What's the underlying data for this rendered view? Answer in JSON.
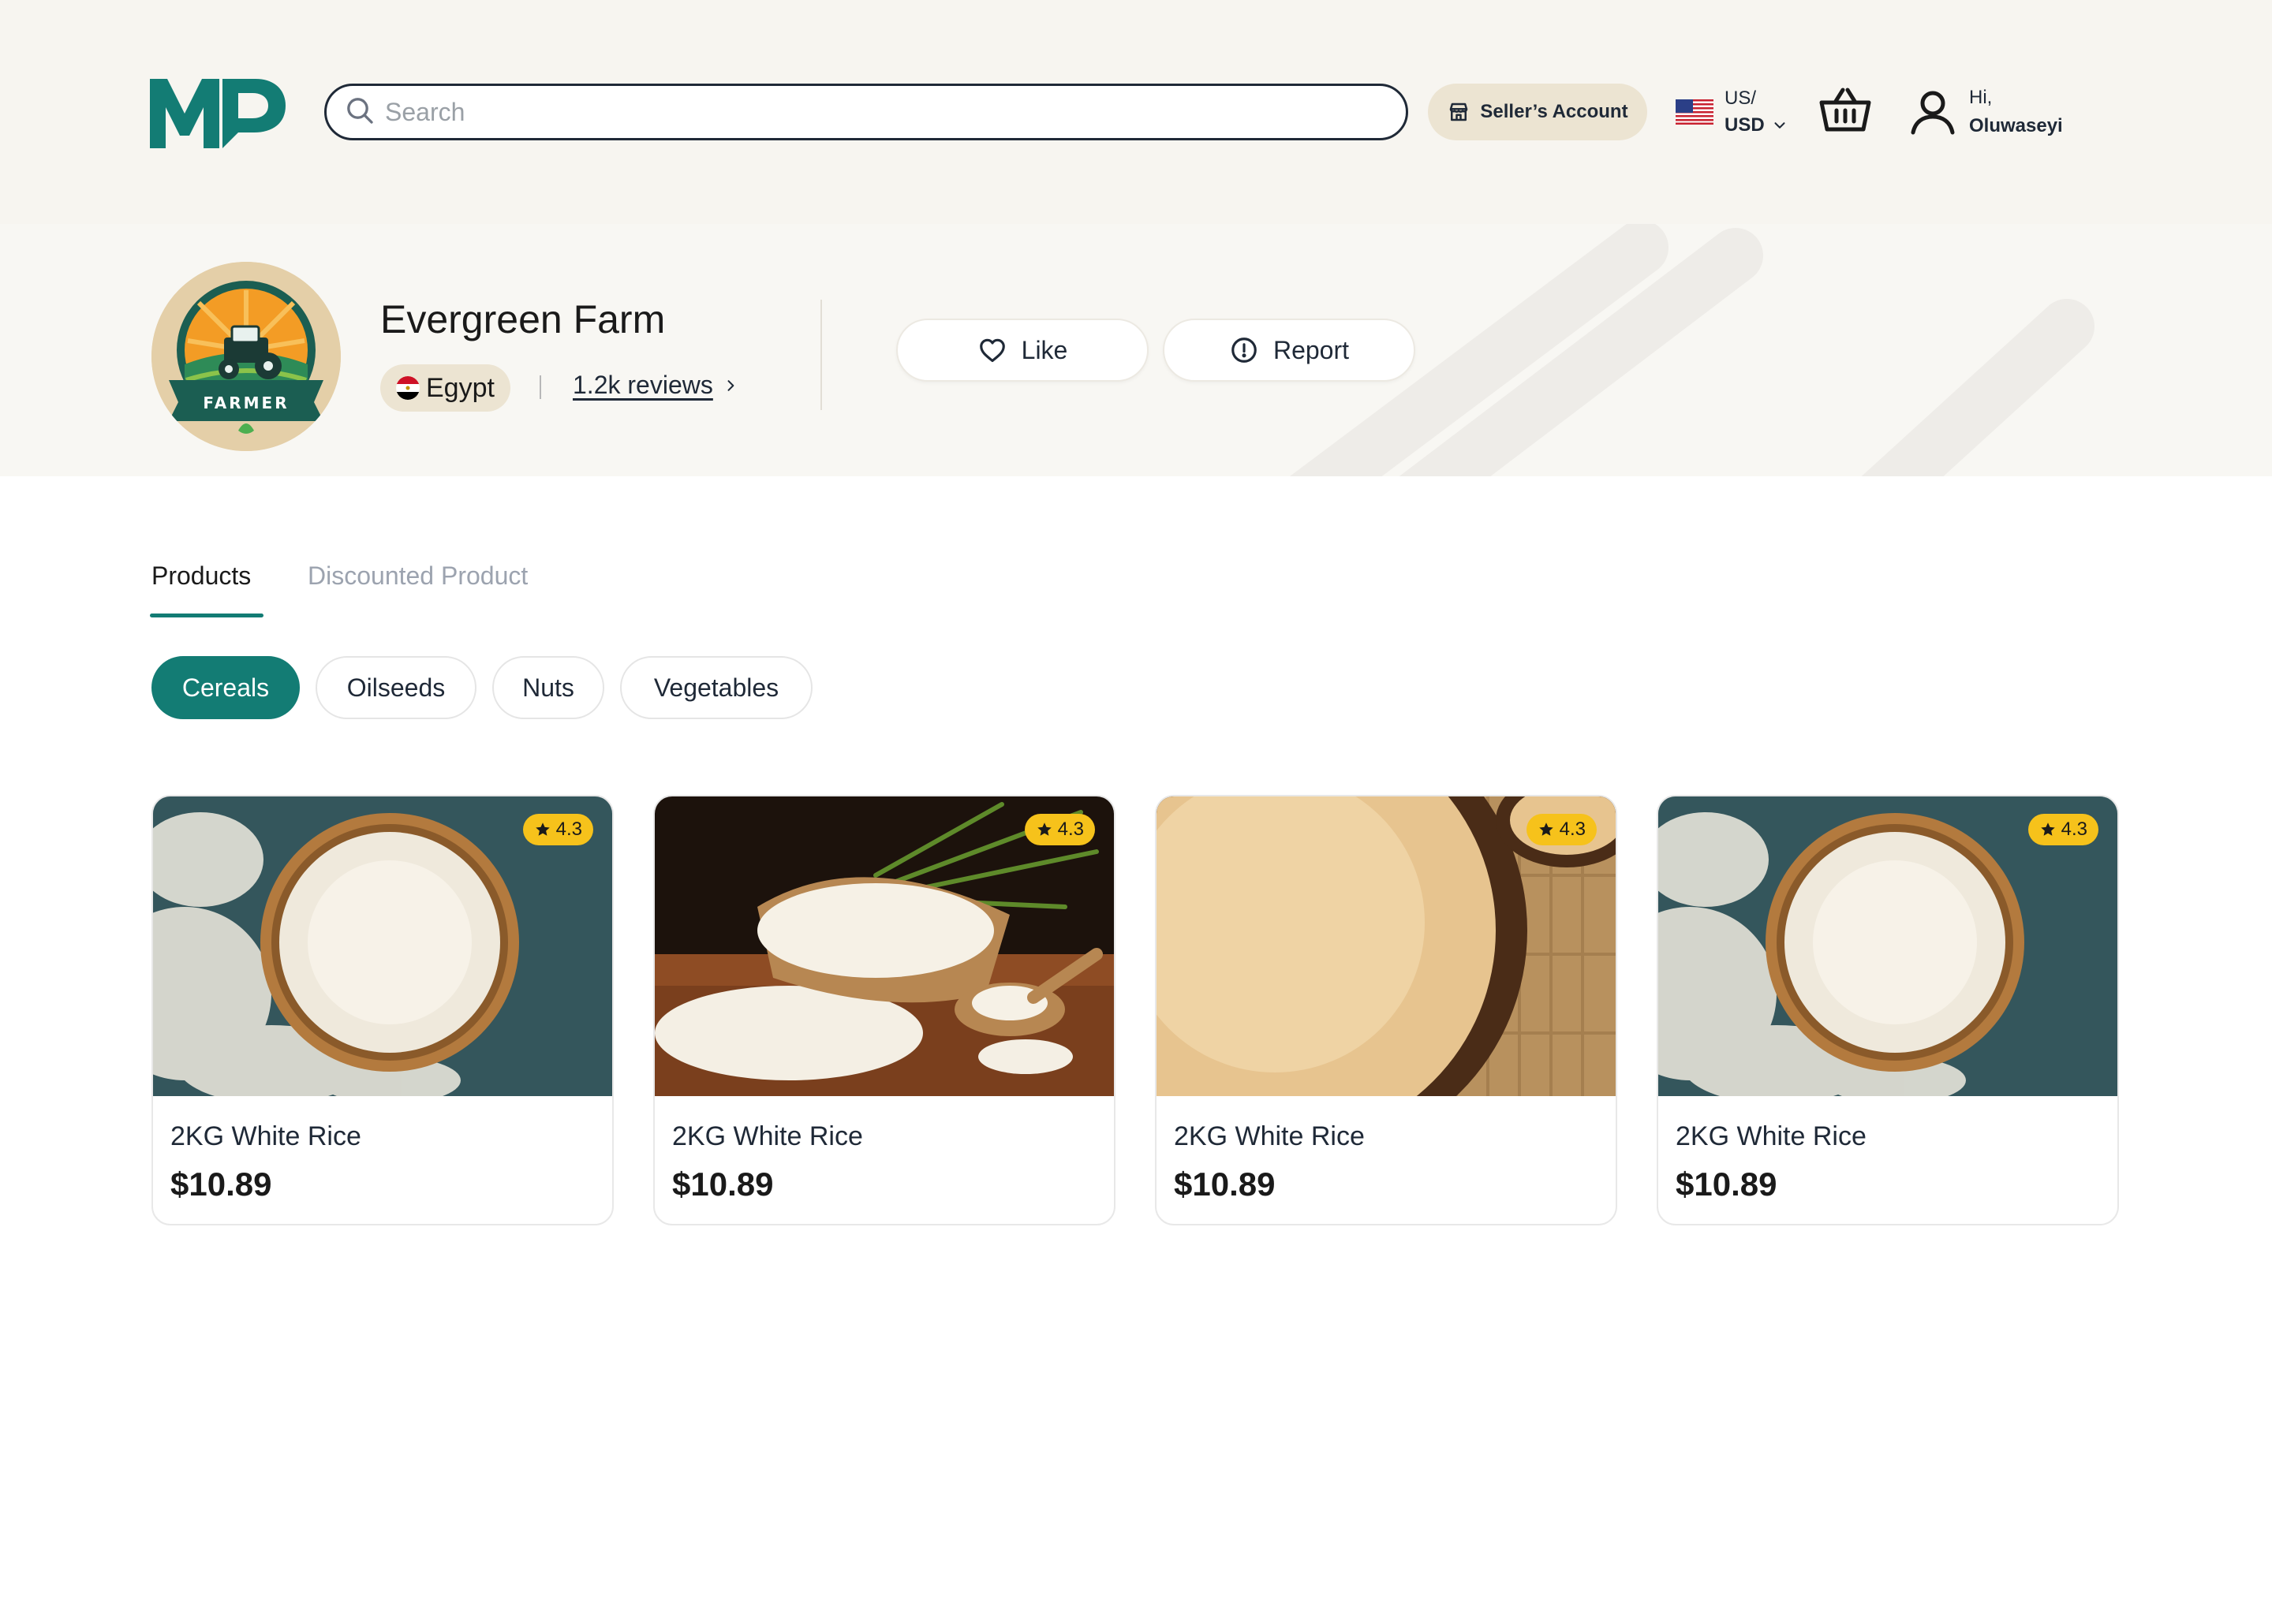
{
  "header": {
    "logo_text": "MP",
    "search": {
      "placeholder": "Search"
    },
    "seller_button": "Seller’s Account",
    "locale": {
      "region": "US/",
      "currency": "USD"
    },
    "user": {
      "greeting": "Hi,",
      "name": "Oluwaseyi"
    }
  },
  "store": {
    "name": "Evergreen Farm",
    "country": "Egypt",
    "reviews": "1.2k reviews",
    "avatar_text": "FARMER",
    "actions": {
      "like": "Like",
      "report": "Report"
    }
  },
  "tabs": [
    {
      "label": "Products",
      "active": true
    },
    {
      "label": "Discounted Product",
      "active": false
    }
  ],
  "categories": [
    {
      "label": "Cereals",
      "active": true
    },
    {
      "label": "Oilseeds",
      "active": false
    },
    {
      "label": "Nuts",
      "active": false
    },
    {
      "label": "Vegetables",
      "active": false
    }
  ],
  "products": [
    {
      "title": "2KG White Rice",
      "price": "$10.89",
      "rating": "4.3",
      "image": "white-rice-bowl"
    },
    {
      "title": "2KG White Rice",
      "price": "$10.89",
      "rating": "4.3",
      "image": "rice-wooden-spoon"
    },
    {
      "title": "2KG White Rice",
      "price": "$10.89",
      "rating": "4.3",
      "image": "brown-rice-bowl"
    },
    {
      "title": "2KG White Rice",
      "price": "$10.89",
      "rating": "4.3",
      "image": "white-rice-bowl"
    }
  ],
  "colors": {
    "brand": "#137c74",
    "header_bg": "#f7f5f0",
    "accent_beige": "#ece4d2",
    "rating_badge": "#f6c21b"
  },
  "icons": [
    "search-icon",
    "store-icon",
    "us-flag-icon",
    "chevron-down-icon",
    "basket-icon",
    "user-icon",
    "egypt-flag-icon",
    "chevron-right-icon",
    "heart-icon",
    "alert-circle-icon",
    "star-icon"
  ]
}
